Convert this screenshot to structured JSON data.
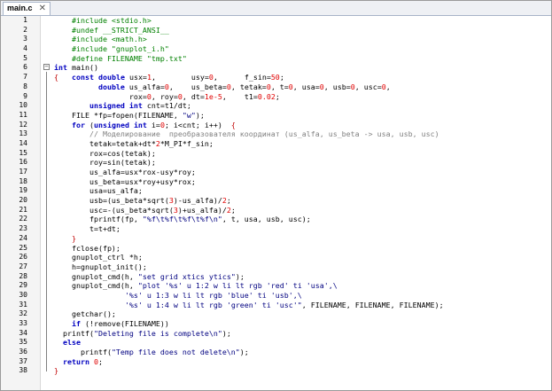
{
  "tab": {
    "label": "main.c",
    "close": "✕"
  },
  "lines": [
    [
      {
        "t": "    #include <stdio.h>",
        "c": "pp"
      }
    ],
    [
      {
        "t": "    #undef __STRICT_ANSI__",
        "c": "pp"
      }
    ],
    [
      {
        "t": "    #include <math.h>",
        "c": "pp"
      }
    ],
    [
      {
        "t": "    #include \"gnuplot_i.h\"",
        "c": "pp"
      }
    ],
    [
      {
        "t": "    #define FILENAME \"tmp.txt\"",
        "c": "pp"
      }
    ],
    [
      {
        "t": "int",
        "c": "kw"
      },
      {
        "t": " main()",
        "c": "pl"
      }
    ],
    [
      {
        "t": "{",
        "c": "op"
      },
      {
        "t": "   ",
        "c": "pl"
      },
      {
        "t": "const double",
        "c": "kw"
      },
      {
        "t": " usx=",
        "c": "pl"
      },
      {
        "t": "1",
        "c": "num"
      },
      {
        "t": ",        usy=",
        "c": "pl"
      },
      {
        "t": "0",
        "c": "num"
      },
      {
        "t": ",      f_sin=",
        "c": "pl"
      },
      {
        "t": "50",
        "c": "num"
      },
      {
        "t": ";",
        "c": "pl"
      }
    ],
    [
      {
        "t": "          ",
        "c": "pl"
      },
      {
        "t": "double",
        "c": "kw"
      },
      {
        "t": " us_alfa=",
        "c": "pl"
      },
      {
        "t": "0",
        "c": "num"
      },
      {
        "t": ",    us_beta=",
        "c": "pl"
      },
      {
        "t": "0",
        "c": "num"
      },
      {
        "t": ", tetak=",
        "c": "pl"
      },
      {
        "t": "0",
        "c": "num"
      },
      {
        "t": ", t=",
        "c": "pl"
      },
      {
        "t": "0",
        "c": "num"
      },
      {
        "t": ", usa=",
        "c": "pl"
      },
      {
        "t": "0",
        "c": "num"
      },
      {
        "t": ", usb=",
        "c": "pl"
      },
      {
        "t": "0",
        "c": "num"
      },
      {
        "t": ", usc=",
        "c": "pl"
      },
      {
        "t": "0",
        "c": "num"
      },
      {
        "t": ",",
        "c": "pl"
      }
    ],
    [
      {
        "t": "                 rox=",
        "c": "pl"
      },
      {
        "t": "0",
        "c": "num"
      },
      {
        "t": ", roy=",
        "c": "pl"
      },
      {
        "t": "0",
        "c": "num"
      },
      {
        "t": ", dt=",
        "c": "pl"
      },
      {
        "t": "1e-5",
        "c": "num"
      },
      {
        "t": ",    t1=",
        "c": "pl"
      },
      {
        "t": "0.02",
        "c": "num"
      },
      {
        "t": ";",
        "c": "pl"
      }
    ],
    [
      {
        "t": "        ",
        "c": "pl"
      },
      {
        "t": "unsigned int",
        "c": "kw"
      },
      {
        "t": " cnt=t1/dt;",
        "c": "pl"
      }
    ],
    [
      {
        "t": "    FILE *fp=fopen(FILENAME, ",
        "c": "pl"
      },
      {
        "t": "\"w\"",
        "c": "str"
      },
      {
        "t": ");",
        "c": "pl"
      }
    ],
    [
      {
        "t": "    ",
        "c": "pl"
      },
      {
        "t": "for",
        "c": "kw"
      },
      {
        "t": " (",
        "c": "pl"
      },
      {
        "t": "unsigned int",
        "c": "kw"
      },
      {
        "t": " i=",
        "c": "pl"
      },
      {
        "t": "0",
        "c": "num"
      },
      {
        "t": "; i<cnt; i++)  ",
        "c": "pl"
      },
      {
        "t": "{",
        "c": "op"
      }
    ],
    [
      {
        "t": "        // Моделирование  преобразователя координат (us_alfa, us_beta -> usa, usb, usc)",
        "c": "cmt"
      }
    ],
    [
      {
        "t": "        tetak=tetak+dt*",
        "c": "pl"
      },
      {
        "t": "2",
        "c": "num"
      },
      {
        "t": "*M_PI*f_sin;",
        "c": "pl"
      }
    ],
    [
      {
        "t": "        rox=cos(tetak);",
        "c": "pl"
      }
    ],
    [
      {
        "t": "        roy=sin(tetak);",
        "c": "pl"
      }
    ],
    [
      {
        "t": "        us_alfa=usx*rox-usy*roy;",
        "c": "pl"
      }
    ],
    [
      {
        "t": "        us_beta=usx*roy+usy*rox;",
        "c": "pl"
      }
    ],
    [
      {
        "t": "        usa=us_alfa;",
        "c": "pl"
      }
    ],
    [
      {
        "t": "        usb=(us_beta*sqrt(",
        "c": "pl"
      },
      {
        "t": "3",
        "c": "num"
      },
      {
        "t": ")-us_alfa)/",
        "c": "pl"
      },
      {
        "t": "2",
        "c": "num"
      },
      {
        "t": ";",
        "c": "pl"
      }
    ],
    [
      {
        "t": "        usc=-(us_beta*sqrt(",
        "c": "pl"
      },
      {
        "t": "3",
        "c": "num"
      },
      {
        "t": ")+us_alfa)/",
        "c": "pl"
      },
      {
        "t": "2",
        "c": "num"
      },
      {
        "t": ";",
        "c": "pl"
      }
    ],
    [
      {
        "t": "        fprintf(fp, ",
        "c": "pl"
      },
      {
        "t": "\"%f\\t%f\\t%f\\t%f\\n\"",
        "c": "str"
      },
      {
        "t": ", t, usa, usb, usc);",
        "c": "pl"
      }
    ],
    [
      {
        "t": "        t=t+dt;",
        "c": "pl"
      }
    ],
    [
      {
        "t": "    ",
        "c": "pl"
      },
      {
        "t": "}",
        "c": "op"
      }
    ],
    [
      {
        "t": "    fclose(fp);",
        "c": "pl"
      }
    ],
    [
      {
        "t": "    gnuplot_ctrl *h;",
        "c": "pl"
      }
    ],
    [
      {
        "t": "    h=gnuplot_init();",
        "c": "pl"
      }
    ],
    [
      {
        "t": "    gnuplot_cmd(h, ",
        "c": "pl"
      },
      {
        "t": "\"set grid xtics ytics\"",
        "c": "str"
      },
      {
        "t": ");",
        "c": "pl"
      }
    ],
    [
      {
        "t": "    gnuplot_cmd(h, ",
        "c": "pl"
      },
      {
        "t": "\"plot '%s' u 1:2 w li lt rgb 'red' ti 'usa',\\",
        "c": "str"
      }
    ],
    [
      {
        "t": "                ",
        "c": "pl"
      },
      {
        "t": "'%s' u 1:3 w li lt rgb 'blue' ti 'usb',\\",
        "c": "str"
      }
    ],
    [
      {
        "t": "                ",
        "c": "pl"
      },
      {
        "t": "'%s' u 1:4 w li lt rgb 'green' ti 'usc'\"",
        "c": "str"
      },
      {
        "t": ", FILENAME, FILENAME, FILENAME);",
        "c": "pl"
      }
    ],
    [
      {
        "t": "    getchar();",
        "c": "pl"
      }
    ],
    [
      {
        "t": "    ",
        "c": "pl"
      },
      {
        "t": "if",
        "c": "kw"
      },
      {
        "t": " (!remove(FILENAME))",
        "c": "pl"
      }
    ],
    [
      {
        "t": "  printf(",
        "c": "pl"
      },
      {
        "t": "\"Deleting file is complete\\n\"",
        "c": "str"
      },
      {
        "t": ");",
        "c": "pl"
      }
    ],
    [
      {
        "t": "  ",
        "c": "pl"
      },
      {
        "t": "else",
        "c": "kw"
      }
    ],
    [
      {
        "t": "      printf(",
        "c": "pl"
      },
      {
        "t": "\"Temp file does not delete\\n\"",
        "c": "str"
      },
      {
        "t": ");",
        "c": "pl"
      }
    ],
    [
      {
        "t": "  ",
        "c": "pl"
      },
      {
        "t": "return",
        "c": "kw"
      },
      {
        "t": " ",
        "c": "pl"
      },
      {
        "t": "0",
        "c": "num"
      },
      {
        "t": ";",
        "c": "pl"
      }
    ],
    [
      {
        "t": "}",
        "c": "op"
      }
    ]
  ],
  "fold_markers": {
    "6": "−"
  }
}
